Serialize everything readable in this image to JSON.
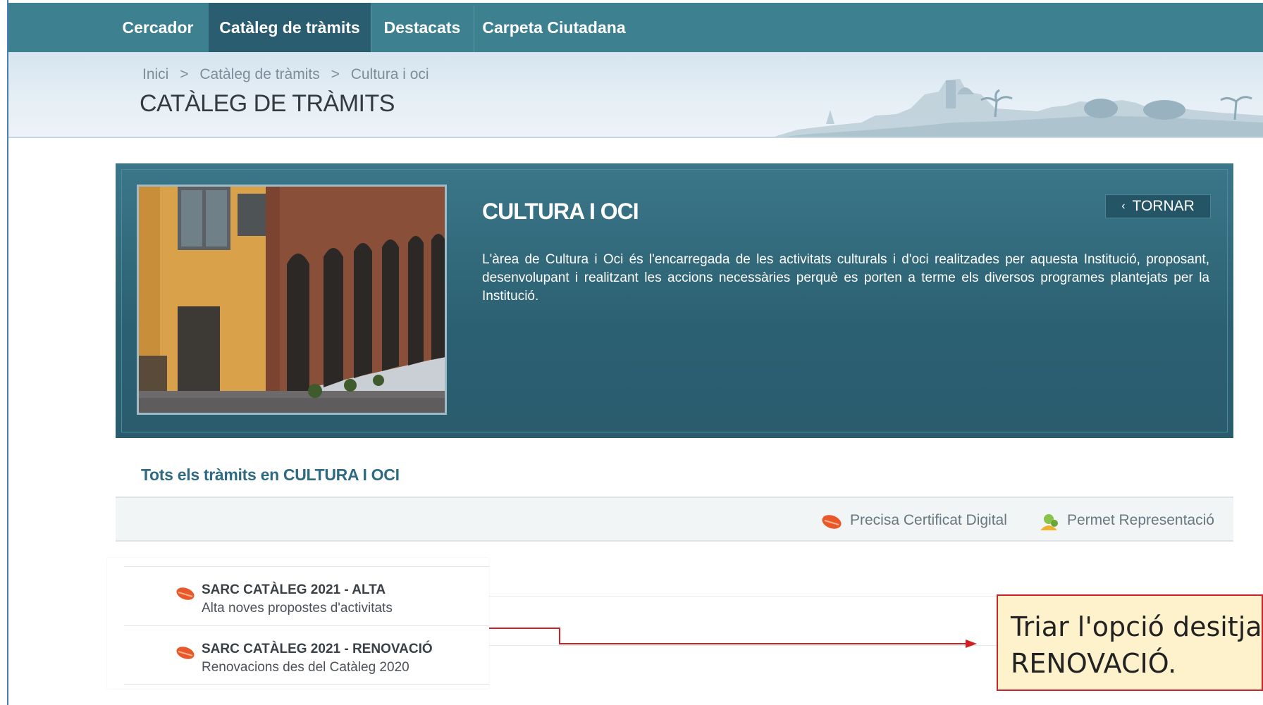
{
  "nav": {
    "items": [
      {
        "label": "Cercador"
      },
      {
        "label": "Catàleg de tràmits"
      },
      {
        "label": "Destacats"
      },
      {
        "label": "Carpeta Ciutadana"
      }
    ]
  },
  "breadcrumb": {
    "items": [
      "Inici",
      "Catàleg de tràmits",
      "Cultura i oci"
    ],
    "separator": ">"
  },
  "page_title": "CATÀLEG DE TRÀMITS",
  "hero": {
    "title": "CULTURA I OCI",
    "back_label": "TORNAR",
    "description": "L'àrea de Cultura i Oci és l'encarregada de les activitats culturals i d'oci realitzades per aquesta Institució, proposant, desenvolupant i realitzant les accions necessàries perquè es porten a terme els diversos programes plantejats per la Institució."
  },
  "section_title": "Tots els tràmits en CULTURA I OCI",
  "legend": {
    "certificate": "Precisa Certificat Digital",
    "representation": "Permet Representació"
  },
  "procedures": [
    {
      "title": "SARC CATÀLEG 2021 - ALTA",
      "subtitle": "Alta noves propostes d'activitats"
    },
    {
      "title": "SARC CATÀLEG 2021 - RENOVACIÓ",
      "subtitle": "Renovacions des del Catàleg 2020"
    }
  ],
  "callout": {
    "line1": "Triar l'opció desitja",
    "line2": "RENOVACIÓ."
  },
  "colors": {
    "nav_bg": "#3d8090",
    "nav_active": "#2a5d6f",
    "hero_bg": "#2f6878",
    "section_title": "#2e6a82",
    "callout_border": "#c8252b",
    "callout_bg": "#fef2cc",
    "arrow": "#d21f26"
  }
}
